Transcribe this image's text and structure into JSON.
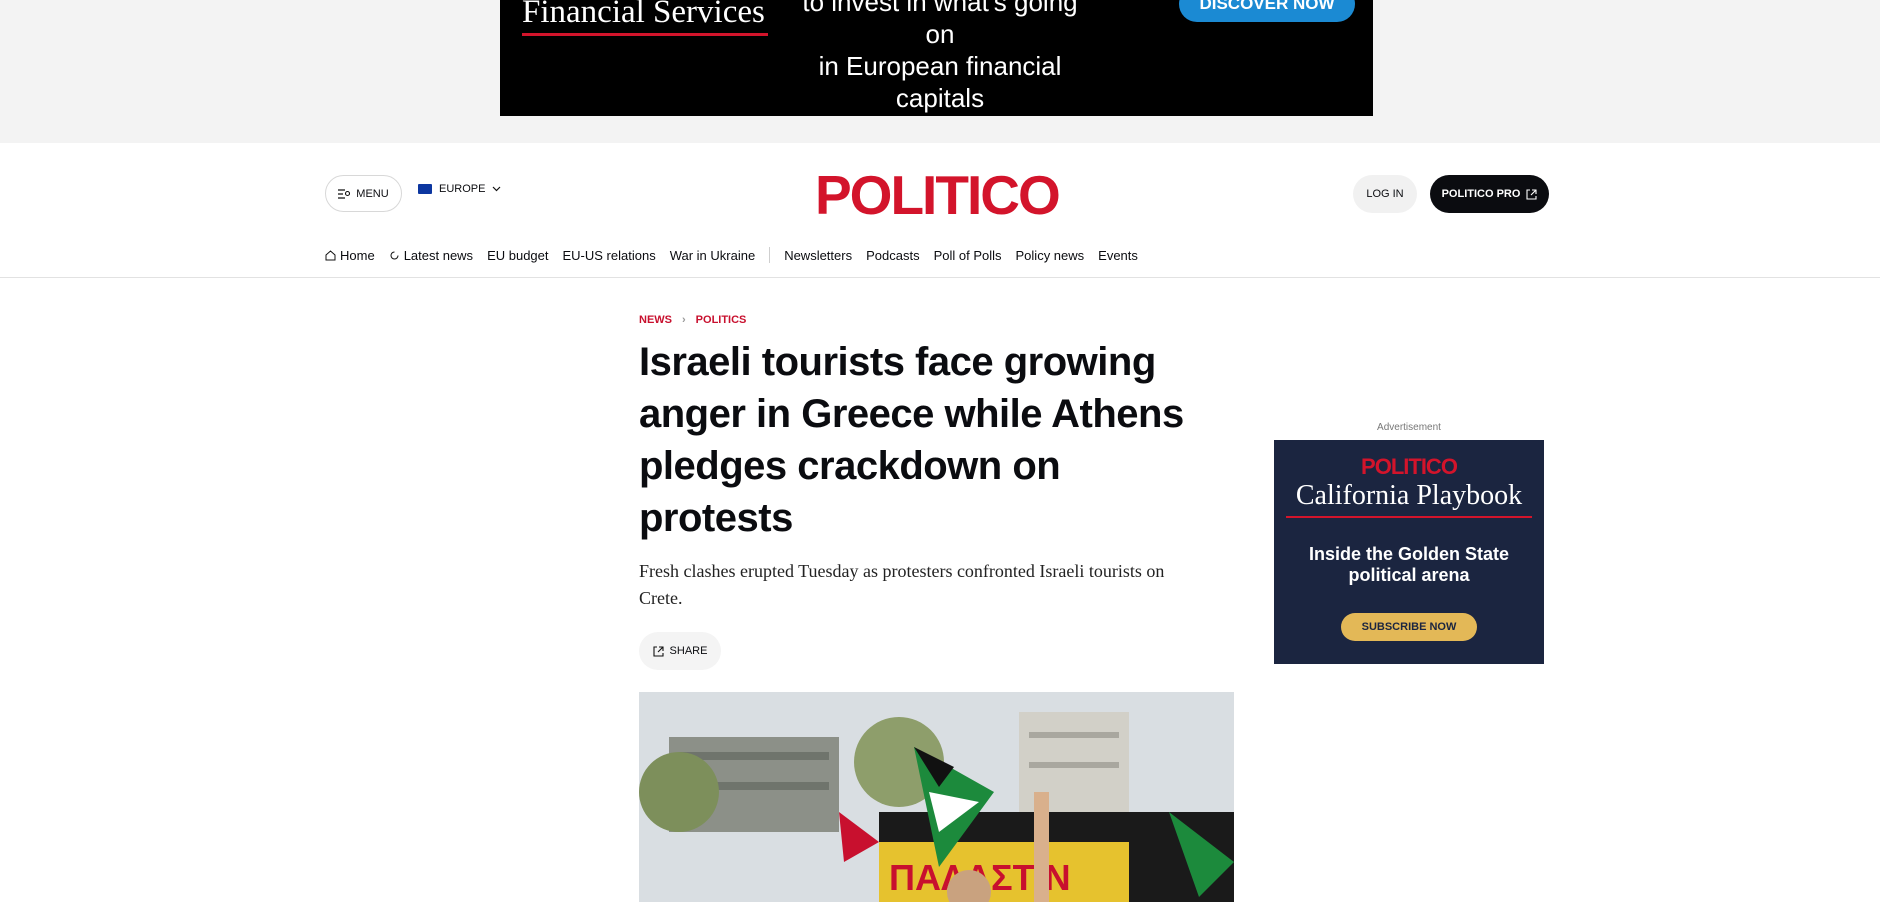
{
  "top_ad": {
    "brand": "Financial Services",
    "copy_line1": "to invest in what's going on",
    "copy_line2": "in European financial capitals",
    "cta": "DISCOVER NOW"
  },
  "header": {
    "menu_label": "MENU",
    "region_label": "EUROPE",
    "logo": "POLITICO",
    "login_label": "LOG IN",
    "pro_label": "POLITICO PRO"
  },
  "nav": {
    "items": [
      "Home",
      "Latest news",
      "EU budget",
      "EU-US relations",
      "War in Ukraine",
      "Newsletters",
      "Podcasts",
      "Poll of Polls",
      "Policy news",
      "Events"
    ]
  },
  "article": {
    "breadcrumb": [
      "NEWS",
      "POLITICS"
    ],
    "headline_lines": [
      "Israeli tourists face growing",
      "anger in Greece while Athens",
      "pledges crackdown on",
      "protests"
    ],
    "dek_lines": [
      "Fresh clashes erupted Tuesday as protesters confronted Israeli tourists on",
      "Crete."
    ],
    "share_label": "SHARE",
    "photo_banner_text": "ΠΑΛΑΣΤΙΝ"
  },
  "side_ad": {
    "label": "Advertisement",
    "logo": "POLITICO",
    "title": "California Playbook",
    "copy_line1": "Inside the Golden State",
    "copy_line2": "political arena",
    "cta": "SUBSCRIBE NOW"
  },
  "colors": {
    "brand_red": "#d3142b",
    "ad_navy": "#1b2540",
    "cta_gold": "#e3b857",
    "discover_blue": "#1b8ad3"
  }
}
